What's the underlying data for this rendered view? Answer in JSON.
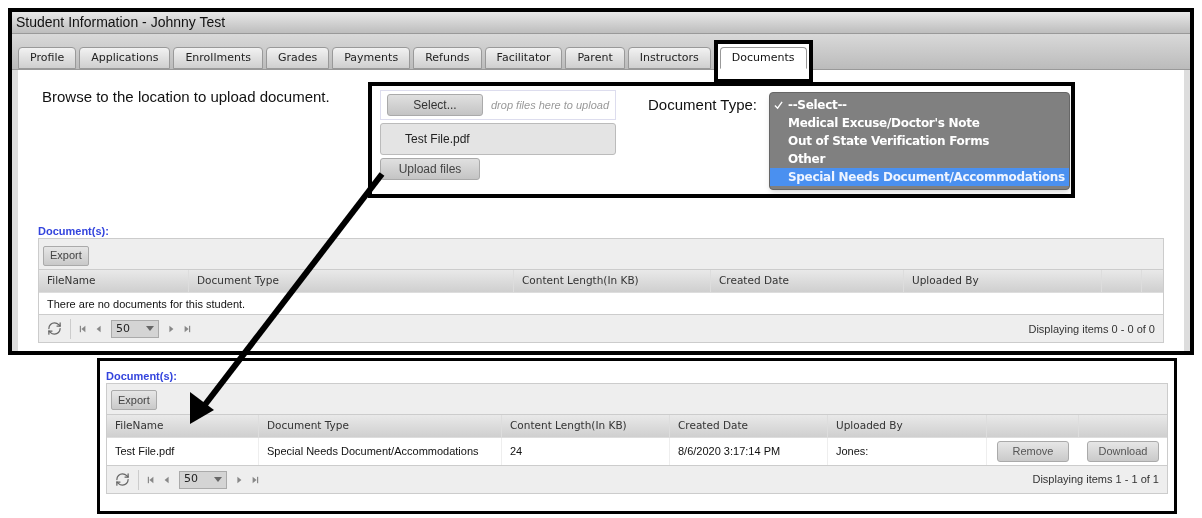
{
  "window": {
    "title": "Student Information - Johnny Test"
  },
  "tabs": [
    {
      "label": "Profile",
      "selected": false
    },
    {
      "label": "Applications",
      "selected": false
    },
    {
      "label": "Enrollments",
      "selected": false
    },
    {
      "label": "Grades",
      "selected": false
    },
    {
      "label": "Payments",
      "selected": false
    },
    {
      "label": "Refunds",
      "selected": false
    },
    {
      "label": "Facilitator",
      "selected": false
    },
    {
      "label": "Parent",
      "selected": false
    },
    {
      "label": "Instructors",
      "selected": false
    },
    {
      "label": "Documents",
      "selected": true
    }
  ],
  "upload": {
    "instruction": "Browse to the location to upload document.",
    "select_button": "Select...",
    "drop_hint": "drop files here to upload",
    "file_name": "Test File.pdf",
    "upload_button": "Upload files",
    "document_type_label": "Document Type:",
    "document_type_options": [
      {
        "label": "--Select--",
        "checked": true,
        "highlighted": false
      },
      {
        "label": "Medical Excuse/Doctor's Note",
        "checked": false,
        "highlighted": false
      },
      {
        "label": "Out of State Verification Forms",
        "checked": false,
        "highlighted": false
      },
      {
        "label": "Other",
        "checked": false,
        "highlighted": false
      },
      {
        "label": "Special Needs Document/Accommodations",
        "checked": false,
        "highlighted": true
      }
    ]
  },
  "documents_grid": {
    "label": "Document(s):",
    "export_button": "Export",
    "columns": [
      "FileName",
      "Document Type",
      "Content Length(In KB)",
      "Created Date",
      "Uploaded By"
    ],
    "empty_message": "There are no documents for this student.",
    "pager": {
      "page_size": "50",
      "info": "Displaying items 0 - 0 of 0"
    }
  },
  "result_inset": {
    "label": "Document(s):",
    "export_button": "Export",
    "columns": [
      "FileName",
      "Document Type",
      "Content Length(In KB)",
      "Created Date",
      "Uploaded By"
    ],
    "rows": [
      {
        "cells": [
          "Test File.pdf",
          "Special Needs Document/Accommodations",
          "24",
          "8/6/2020 3:17:14 PM",
          "Jones:"
        ],
        "actions": [
          "Remove",
          "Download"
        ]
      }
    ],
    "pager": {
      "page_size": "50",
      "info": "Displaying items 1 - 1 of 1"
    }
  }
}
